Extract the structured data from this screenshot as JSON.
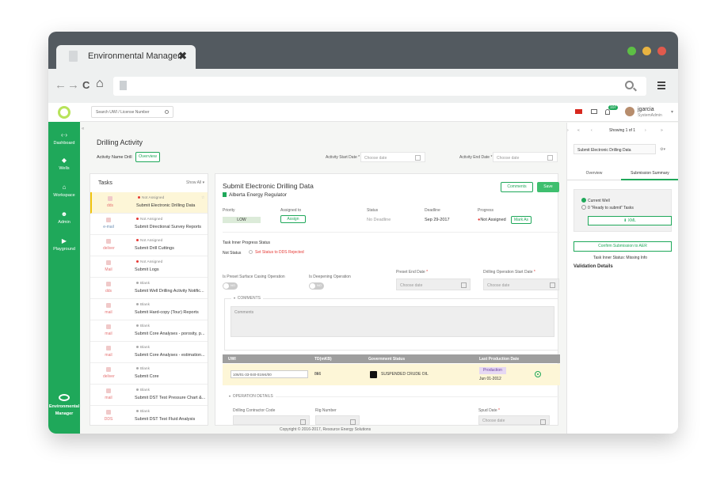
{
  "browser": {
    "tab_title": "Environmental Manager",
    "tab_close": "✖",
    "back": "←",
    "forward": "→",
    "reload": "C",
    "home": "⌂",
    "traffic_colors": [
      "#5dbf45",
      "#e8b341",
      "#e05a4d"
    ]
  },
  "sidebar": {
    "items": [
      {
        "label": "Dashboard",
        "icon": "dashboard-icon",
        "glyph": "‹·›"
      },
      {
        "label": "Wells",
        "icon": "wells-icon",
        "glyph": "◆"
      },
      {
        "label": "Workspace",
        "icon": "workspace-icon",
        "glyph": "⌂"
      },
      {
        "label": "Admin",
        "icon": "admin-icon",
        "glyph": "☻"
      },
      {
        "label": "Playground",
        "icon": "playground-icon",
        "glyph": "▶"
      }
    ],
    "brand_line1": "Environmental",
    "brand_line2": "Manager",
    "brand_color": "#1fa85a"
  },
  "topbar": {
    "search_placeholder": "Search UWI / License Number",
    "notif_count": "107",
    "user_name": "jgarcia",
    "user_role": "SystemAdmin"
  },
  "activity": {
    "heading": "Drilling Activity",
    "name_label": "Activity Name Drill",
    "overview_button": "Overview",
    "start_label": "Activity Start Date",
    "end_label": "Activity End Date",
    "date_placeholder": "Choose date"
  },
  "tasks": {
    "heading": "Tasks",
    "show_all": "Show All ▾",
    "items": [
      {
        "type": "dds",
        "status": "Not Assigned",
        "name": "Submit Electronic Drilling Data"
      },
      {
        "type": "e-mail",
        "status": "Not Assigned",
        "name": "Submit Directional Survey Reports"
      },
      {
        "type": "deliver",
        "status": "Not Assigned",
        "name": "Submit Drill Cuttings"
      },
      {
        "type": "Mail",
        "status": "Not Assigned",
        "name": "Submit Logs"
      },
      {
        "type": "dds",
        "status": "Blank",
        "name": "Submit Well Drilling Activity Notific..."
      },
      {
        "type": "mail",
        "status": "Blank",
        "name": "Submit Hard-copy (Tour) Reports"
      },
      {
        "type": "mail",
        "status": "Blank",
        "name": "Submit Core Analyses - porosity, p..."
      },
      {
        "type": "mail",
        "status": "Blank",
        "name": "Submit Core Analyses - estimation..."
      },
      {
        "type": "deliver",
        "status": "Blank",
        "name": "Submit Core"
      },
      {
        "type": "mail",
        "status": "Blank",
        "name": "Submit DST Test Pressure Chart &..."
      },
      {
        "type": "DDS",
        "status": "Blank",
        "name": "Submit DST Test Fluid Analysis"
      }
    ]
  },
  "detail": {
    "title": "Submit Electronic Drilling Data",
    "regulator": "Alberta Energy Regulator",
    "comments_button": "Comments",
    "save_button": "Save",
    "priority_label": "Priority",
    "priority_value": "LOW",
    "assigned_label": "Assigned to",
    "assign_button": "Assign",
    "status_label": "Status",
    "status_value": "No Deadline",
    "deadline_label": "Deadline",
    "deadline_value": "Sep 29-2017",
    "progress_label": "Progress",
    "progress_value": "Not Assigned",
    "mark_as_button": "Mark As",
    "inner_progress_label": "Task Inner Progress Status",
    "not_status": "Not Status",
    "set_status": "Set Status to DDS Rejected",
    "preset_casing_label": "Is Preset Surface Casing Operation",
    "deepening_label": "Is Deepening Operation",
    "toggle_off": "NO",
    "preset_end_label": "Preset End Date",
    "drilling_start_label": "Drilling Operation Start Date",
    "required_mark": "*",
    "date_placeholder": "Choose date",
    "comments_section": "COMMENTS",
    "comments_placeholder": "Comments",
    "table": {
      "headers": [
        "UWI",
        "TD(mKB)",
        "Government Status",
        "Last Production Date"
      ],
      "uwi": "106/01-33-040-01W4/00",
      "td": "866",
      "gov_status": "SUSPENDED CRUDE OIL",
      "prod_badge": "Production",
      "prod_date": "Jun 01-2012"
    },
    "operation_section": "OPERATION DETAILS",
    "contractor_label": "Drilling Contractor Code",
    "rig_label": "Rig Number",
    "spud_label": "Spud Date"
  },
  "footer": "Copyright © 2016-2017, Resource Energy Solutions",
  "right_panel": {
    "showing": "Showing 1 of 1",
    "well_select": "Submit Electronic Drilling Data",
    "tab_overview": "Overview",
    "tab_summary": "Submission Summary",
    "opt_current": "Current Well",
    "opt_ready": "0 \"Ready to submit\" Tasks",
    "xml_button": "XML",
    "confirm_button": "Confirm Submission to AER",
    "inner_status": "Task Inner Status: Missing Info",
    "validation": "Validation Details"
  }
}
